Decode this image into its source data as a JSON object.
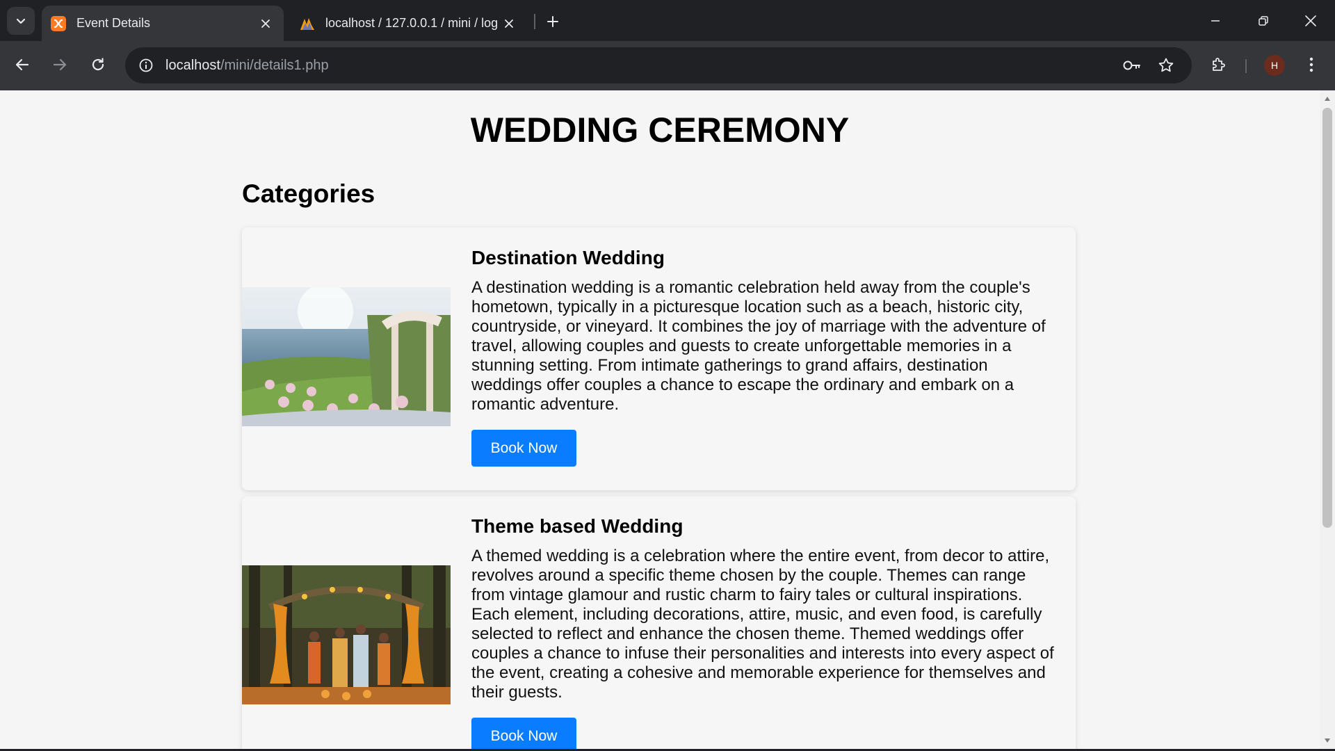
{
  "browser": {
    "tabs": [
      {
        "title": "Event Details",
        "active": true
      },
      {
        "title": "localhost / 127.0.0.1 / mini / log",
        "active": false
      }
    ],
    "url_host": "localhost",
    "url_path": "/mini/details1.php",
    "profile_initial": "H"
  },
  "page": {
    "title": "WEDDING CEREMONY",
    "section_title": "Categories",
    "cards": [
      {
        "title": "Destination Wedding",
        "description": "A destination wedding is a romantic celebration held away from the couple's hometown, typically in a picturesque location such as a beach, historic city, countryside, or vineyard. It combines the joy of marriage with the adventure of travel, allowing couples and guests to create unforgettable memories in a stunning setting. From intimate gatherings to grand affairs, destination weddings offer couples a chance to escape the ordinary and embark on a romantic adventure.",
        "button_label": "Book Now"
      },
      {
        "title": "Theme based Wedding",
        "description": "A themed wedding is a celebration where the entire event, from decor to attire, revolves around a specific theme chosen by the couple. Themes can range from vintage glamour and rustic charm to fairy tales or cultural inspirations. Each element, including decorations, attire, music, and even food, is carefully selected to reflect and enhance the chosen theme. Themed weddings offer couples a chance to infuse their personalities and interests into every aspect of the event, creating a cohesive and memorable experience for themselves and their guests.",
        "button_label": "Book Now"
      }
    ]
  },
  "colors": {
    "button": "#0a7cff",
    "chrome_dark": "#202124",
    "chrome_mid": "#35363a",
    "page_bg": "#f5f5f5"
  }
}
